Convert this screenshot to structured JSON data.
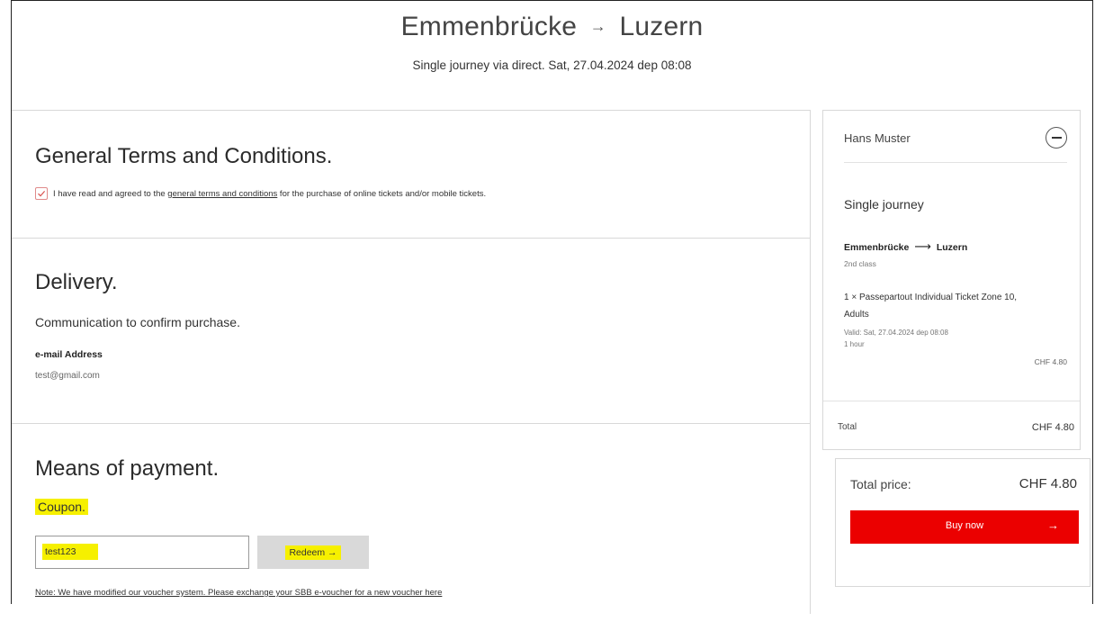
{
  "header": {
    "from": "Emmenbrücke",
    "to": "Luzern",
    "arrow": "→",
    "subtitle": "Single journey via direct. Sat, 27.04.2024 dep 08:08"
  },
  "terms": {
    "title": "General Terms and Conditions.",
    "checked": true,
    "text_before": "I have read and agreed to the ",
    "link_text": "general terms and conditions",
    "text_after": " for the purchase of online tickets and/or mobile tickets."
  },
  "delivery": {
    "title": "Delivery.",
    "description": "Communication to confirm purchase.",
    "email_label": "e-mail Address",
    "email_value": "test@gmail.com"
  },
  "payment": {
    "title": "Means of payment.",
    "coupon_label": "Coupon.",
    "coupon_value": "test123",
    "redeem_label": "Redeem →",
    "note": "Note: We have modified our voucher system. Please exchange your SBB e-voucher for a new voucher here"
  },
  "summary": {
    "passenger": "Hans Muster",
    "ticket_type": "Single journey",
    "route_from": "Emmenbrücke",
    "route_arrow": "⟶",
    "route_to": "Luzern",
    "class": "2nd class",
    "item_line1": "1 × Passepartout Individual Ticket Zone 10,",
    "item_line2": "Adults",
    "valid": "Valid: Sat, 27.04.2024 dep 08:08",
    "duration": "1 hour",
    "item_price": "CHF 4.80",
    "total_label": "Total",
    "total_value": "CHF 4.80"
  },
  "checkout": {
    "total_price_label": "Total price:",
    "total_price_value": "CHF 4.80",
    "buy_label": "Buy now",
    "buy_arrow": "→"
  },
  "colors": {
    "accent_red": "#eb0000",
    "highlight_yellow": "#f6f000",
    "checkbox_border": "#e08a8a"
  }
}
